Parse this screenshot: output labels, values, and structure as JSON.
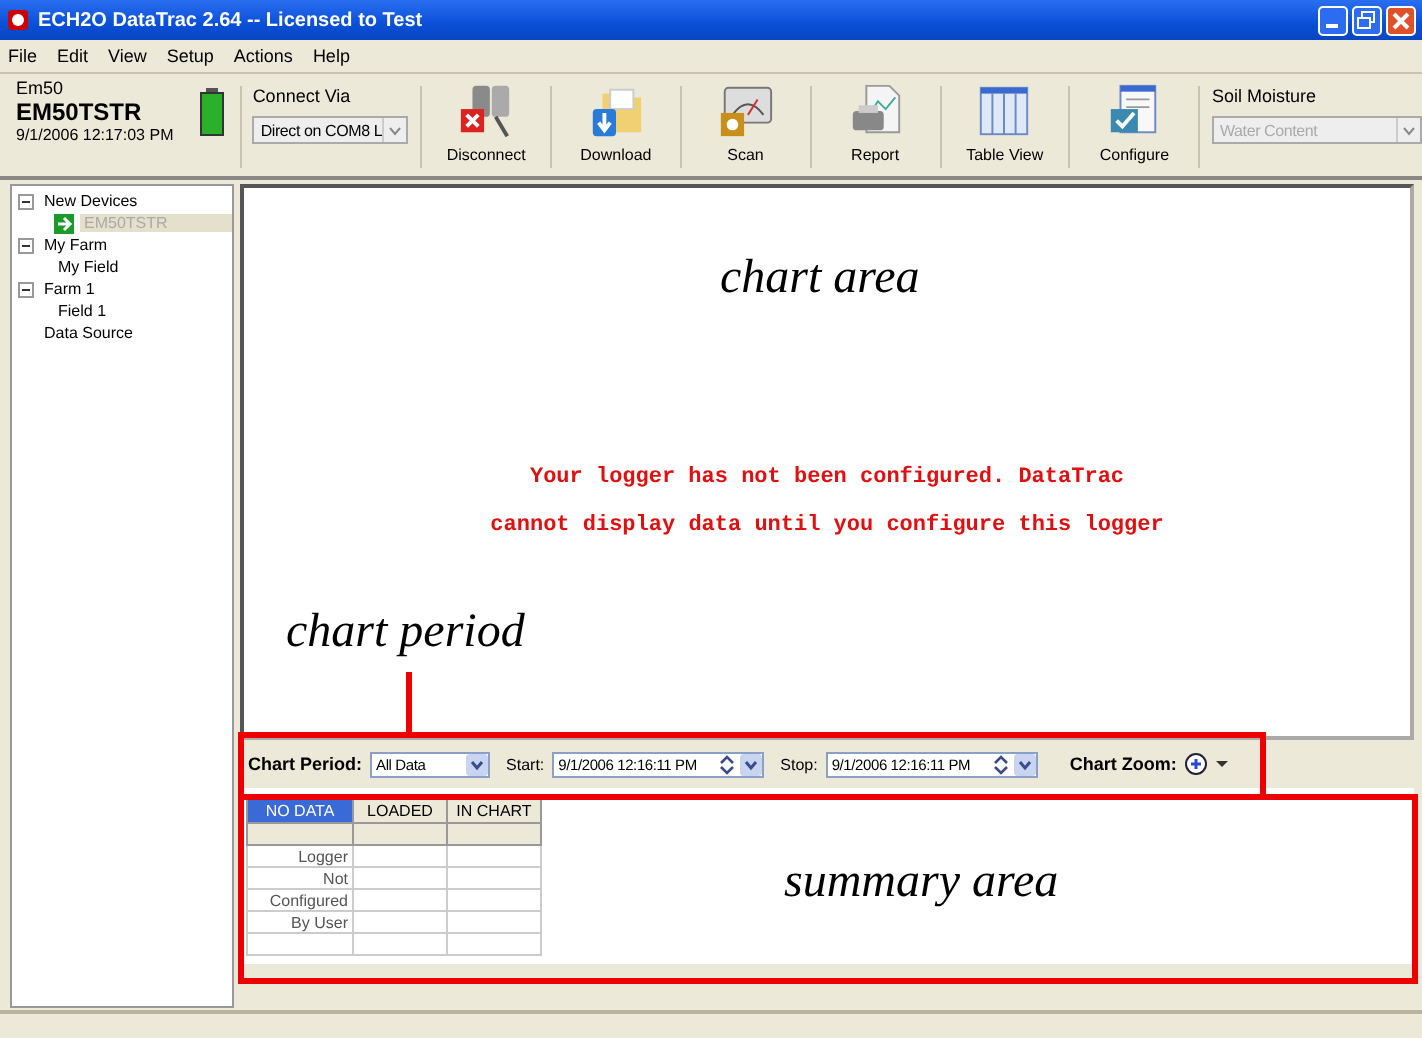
{
  "window": {
    "title": "ECH2O DataTrac 2.64 -- Licensed to Test"
  },
  "menu": [
    {
      "label": "File"
    },
    {
      "label": "Edit"
    },
    {
      "label": "View"
    },
    {
      "label": "Setup"
    },
    {
      "label": "Actions"
    },
    {
      "label": "Help"
    }
  ],
  "device": {
    "model": "Em50",
    "name": "EM50TSTR",
    "time": "9/1/2006 12:17:03 PM"
  },
  "connect": {
    "label": "Connect Via",
    "value": "Direct on COM8 L"
  },
  "toolbar": [
    {
      "kind": "disconnect",
      "label": "Disconnect"
    },
    {
      "kind": "download",
      "label": "Download"
    },
    {
      "kind": "scan",
      "label": "Scan"
    },
    {
      "kind": "report",
      "label": "Report"
    },
    {
      "kind": "table",
      "label": "Table View"
    },
    {
      "kind": "configure",
      "label": "Configure"
    }
  ],
  "soil_moisture": {
    "label": "Soil Moisture",
    "value": "Water Content",
    "disabled": true
  },
  "tree": [
    {
      "label": "New Devices",
      "expanded": true,
      "selected": false,
      "children": [
        {
          "label": "EM50TSTR",
          "selected": true,
          "kind": "device"
        }
      ]
    },
    {
      "label": "My Farm",
      "expanded": true,
      "selected": false,
      "children": [
        {
          "label": "My Field",
          "selected": false
        }
      ]
    },
    {
      "label": "Farm 1",
      "expanded": true,
      "selected": false,
      "children": [
        {
          "label": "Field 1",
          "selected": false
        }
      ]
    },
    {
      "label": "Data Source",
      "selected": false
    }
  ],
  "chart_message": [
    "Your logger has not been configured. DataTrac",
    "cannot display data until you configure this logger"
  ],
  "chart_period": {
    "label": "Chart Period:",
    "value": "All Data",
    "start_label": "Start:",
    "start": "9/1/2006 12:16:11 PM",
    "stop_label": "Stop:",
    "stop": "9/1/2006 12:16:11 PM",
    "zoom_label": "Chart Zoom:"
  },
  "summary": {
    "columns": [
      {
        "label": "NO DATA",
        "selected": true
      },
      {
        "label": "LOADED",
        "selected": false
      },
      {
        "label": "IN CHART",
        "selected": false
      }
    ],
    "rows": [
      {
        "label": "Logger"
      },
      {
        "label": "Not"
      },
      {
        "label": "Configured"
      },
      {
        "label": "By User"
      }
    ]
  },
  "annotations": [
    {
      "kind": "chart",
      "text": "chart area"
    },
    {
      "kind": "period",
      "text": "chart period"
    },
    {
      "kind": "summary",
      "text": "summary area"
    }
  ]
}
